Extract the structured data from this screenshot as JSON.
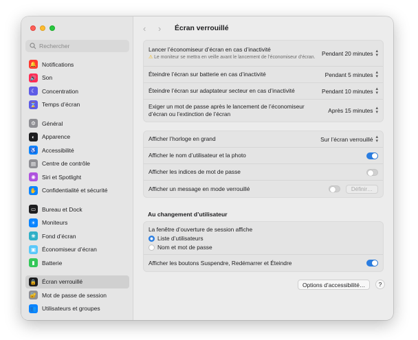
{
  "search": {
    "placeholder": "Rechercher"
  },
  "sidebar": {
    "items": [
      {
        "label": "Notifications",
        "icon": "bell-icon",
        "color": "#ff3b30",
        "glyph": "🔔"
      },
      {
        "label": "Son",
        "icon": "speaker-icon",
        "color": "#ff2d55",
        "glyph": "🔊"
      },
      {
        "label": "Concentration",
        "icon": "moon-icon",
        "color": "#5e5ce6",
        "glyph": "☾"
      },
      {
        "label": "Temps d’écran",
        "icon": "hourglass-icon",
        "color": "#5e5ce6",
        "glyph": "⌛"
      },
      {
        "label": "Général",
        "icon": "gear-icon",
        "color": "#8e8e93",
        "glyph": "⚙"
      },
      {
        "label": "Apparence",
        "icon": "appearance-icon",
        "color": "#1d1d1f",
        "glyph": "◐"
      },
      {
        "label": "Accessibilité",
        "icon": "accessibility-icon",
        "color": "#0a84ff",
        "glyph": "♿"
      },
      {
        "label": "Centre de contrôle",
        "icon": "control-center-icon",
        "color": "#8e8e93",
        "glyph": "▤"
      },
      {
        "label": "Siri et Spotlight",
        "icon": "siri-icon",
        "color": "#af52de",
        "glyph": "◉"
      },
      {
        "label": "Confidentialité et sécurité",
        "icon": "hand-icon",
        "color": "#0a84ff",
        "glyph": "✋"
      },
      {
        "label": "Bureau et Dock",
        "icon": "dock-icon",
        "color": "#1d1d1f",
        "glyph": "▭"
      },
      {
        "label": "Moniteurs",
        "icon": "sun-icon",
        "color": "#0a84ff",
        "glyph": "☀"
      },
      {
        "label": "Fond d’écran",
        "icon": "wallpaper-icon",
        "color": "#30b0c7",
        "glyph": "❀"
      },
      {
        "label": "Économiseur d’écran",
        "icon": "screensaver-icon",
        "color": "#5ac8fa",
        "glyph": "▣"
      },
      {
        "label": "Batterie",
        "icon": "battery-icon",
        "color": "#34c759",
        "glyph": "▮"
      },
      {
        "label": "Écran verrouillé",
        "icon": "lock-screen-icon",
        "color": "#1d1d1f",
        "glyph": "🔒"
      },
      {
        "label": "Mot de passe de session",
        "icon": "lock-icon",
        "color": "#8e8e93",
        "glyph": "🔐"
      },
      {
        "label": "Utilisateurs et groupes",
        "icon": "users-icon",
        "color": "#0a84ff",
        "glyph": "👥"
      }
    ]
  },
  "header": {
    "title": "Écran verrouillé"
  },
  "group1": {
    "screensaver": {
      "label": "Lancer l’économiseur d’écran en cas d’inactivité",
      "warning": "Le moniteur se mettra en veille avant le lancement de l’économiseur d’écran.",
      "value": "Pendant 20 minutes"
    },
    "battery": {
      "label": "Éteindre l’écran sur batterie en cas d’inactivité",
      "value": "Pendant 5 minutes"
    },
    "adapter": {
      "label": "Éteindre l’écran sur adaptateur secteur en cas d’inactivité",
      "value": "Pendant 10 minutes"
    },
    "password": {
      "label": "Exiger un mot de passe après le lancement de l’économiseur d’écran ou l’extinction de l’écran",
      "value": "Après 15 minutes"
    }
  },
  "group2": {
    "clock": {
      "label": "Afficher l’horloge en grand",
      "value": "Sur l’écran verrouillé"
    },
    "username": {
      "label": "Afficher le nom d’utilisateur et la photo",
      "on": true
    },
    "hints": {
      "label": "Afficher les indices de mot de passe",
      "on": false
    },
    "message": {
      "label": "Afficher un message en mode verrouillé",
      "on": false,
      "button": "Définir…"
    }
  },
  "section": {
    "title": "Au changement d’utilisateur"
  },
  "group3": {
    "login_window_label": "La fenêtre d’ouverture de session affiche",
    "option_users": "Liste d’utilisateurs",
    "option_name_password": "Nom et mot de passe",
    "selected": "Liste d’utilisateurs",
    "power_buttons": {
      "label": "Afficher les boutons Suspendre, Redémarrer et Éteindre",
      "on": true
    }
  },
  "footer": {
    "accessibility_button": "Options d’accessibilité…",
    "help": "?"
  },
  "colors": {
    "accent": "#2a7de1",
    "sidebar_selected": "#d0d0d0"
  }
}
